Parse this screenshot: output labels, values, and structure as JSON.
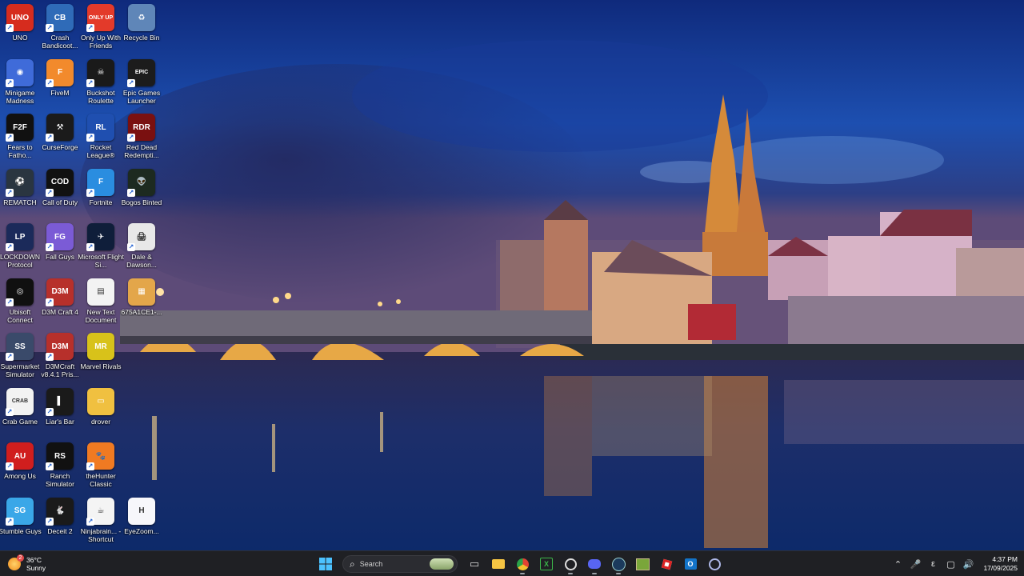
{
  "desktop": {
    "icons": [
      {
        "label": "UNO",
        "glyph": "UNO",
        "bg": "#d62c1e"
      },
      {
        "label": "Crash Bandicoot...",
        "glyph": "CB",
        "bg": "#2f6bb8"
      },
      {
        "label": "Only Up With Friends",
        "glyph": "ONLY UP",
        "bg": "#e33a2a"
      },
      {
        "label": "Recycle Bin",
        "glyph": "♻",
        "bg": "#5f86b8"
      },
      {
        "label": "Minigame Madness",
        "glyph": "◉",
        "bg": "#3f6bd9"
      },
      {
        "label": "FiveM",
        "glyph": "F",
        "bg": "#f28a2c"
      },
      {
        "label": "Buckshot Roulette",
        "glyph": "☠",
        "bg": "#1a1a1a"
      },
      {
        "label": "Epic Games Launcher",
        "glyph": "EPIC",
        "bg": "#1c1c1c"
      },
      {
        "label": "Fears to Fatho...",
        "glyph": "F2F",
        "bg": "#111111"
      },
      {
        "label": "CurseForge",
        "glyph": "⚒",
        "bg": "#1b1b1b"
      },
      {
        "label": "Rocket League®",
        "glyph": "RL",
        "bg": "#1f4fb0"
      },
      {
        "label": "Red Dead Redempti...",
        "glyph": "RDR",
        "bg": "#7a1010"
      },
      {
        "label": "REMATCH",
        "glyph": "⚽",
        "bg": "#2a3540"
      },
      {
        "label": "Call of Duty",
        "glyph": "COD",
        "bg": "#111111"
      },
      {
        "label": "Fortnite",
        "glyph": "F",
        "bg": "#2a8de0"
      },
      {
        "label": "Bogos Binted",
        "glyph": "👽",
        "bg": "#1d2a20"
      },
      {
        "label": "LOCKDOWN Protocol",
        "glyph": "LP",
        "bg": "#1b2a5a"
      },
      {
        "label": "Fall Guys",
        "glyph": "FG",
        "bg": "#7b5bd6"
      },
      {
        "label": "Microsoft Flight Si...",
        "glyph": "✈",
        "bg": "#0f1e3a"
      },
      {
        "label": "Dale & Dawson...",
        "glyph": "🖨",
        "bg": "#e8e8e8"
      },
      {
        "label": "Ubisoft Connect",
        "glyph": "◎",
        "bg": "#101010"
      },
      {
        "label": "D3M Craft 4",
        "glyph": "D3M",
        "bg": "#b7302b"
      },
      {
        "label": "New Text Document",
        "glyph": "▤",
        "bg": "#f3f3f3"
      },
      {
        "label": "675A1CE1-...",
        "glyph": "▦",
        "bg": "#e3a64a"
      },
      {
        "label": "Supermarket Simulator",
        "glyph": "SS",
        "bg": "#3a4a6a"
      },
      {
        "label": "D3MCraft v8.4.1 Pris...",
        "glyph": "D3M",
        "bg": "#b7302b"
      },
      {
        "label": "Marvel Rivals",
        "glyph": "MR",
        "bg": "#d8c21a"
      },
      {
        "label": "",
        "glyph": "",
        "bg": "transparent"
      },
      {
        "label": "Crab Game",
        "glyph": "CRAB",
        "bg": "#f2f2f2"
      },
      {
        "label": "Liar's Bar",
        "glyph": "▌",
        "bg": "#1a1a1a"
      },
      {
        "label": "drover",
        "glyph": "▭",
        "bg": "#f0c040"
      },
      {
        "label": "",
        "glyph": "",
        "bg": "transparent"
      },
      {
        "label": "Among Us",
        "glyph": "AU",
        "bg": "#d01e1e"
      },
      {
        "label": "Ranch Simulator",
        "glyph": "RS",
        "bg": "#111111"
      },
      {
        "label": "theHunter Classic",
        "glyph": "🐾",
        "bg": "#f07a22"
      },
      {
        "label": "",
        "glyph": "",
        "bg": "transparent"
      },
      {
        "label": "Stumble Guys",
        "glyph": "SG",
        "bg": "#3aa7e8"
      },
      {
        "label": "Deceit 2",
        "glyph": "🐇",
        "bg": "#1a1a1a"
      },
      {
        "label": "Ninjabrain... - Shortcut",
        "glyph": "☕",
        "bg": "#f4f4f4"
      },
      {
        "label": "EyeZoom...",
        "glyph": "H",
        "bg": "#f7f7fb"
      }
    ]
  },
  "taskbar": {
    "weather": {
      "temp": "36°C",
      "condition": "Sunny",
      "badge": "2"
    },
    "search_placeholder": "Search",
    "clock": {
      "time": "4:37 PM",
      "date": "17/09/2025"
    },
    "tray_lang": "ε",
    "apps": [
      {
        "name": "task-view",
        "glyph": "▭"
      },
      {
        "name": "file-explorer",
        "glyph": "📁"
      },
      {
        "name": "chrome",
        "glyph": "◍"
      },
      {
        "name": "xbox",
        "glyph": "X"
      },
      {
        "name": "obs",
        "glyph": "◉"
      },
      {
        "name": "discord",
        "glyph": "◐"
      },
      {
        "name": "steam",
        "glyph": "♨"
      },
      {
        "name": "minecraft",
        "glyph": "▣"
      },
      {
        "name": "roblox",
        "glyph": "◆"
      },
      {
        "name": "outlook",
        "glyph": "O"
      },
      {
        "name": "app",
        "glyph": "◎"
      }
    ]
  },
  "colors": {
    "taskbar": "#1f2024",
    "accent": "#4cc2ff"
  }
}
